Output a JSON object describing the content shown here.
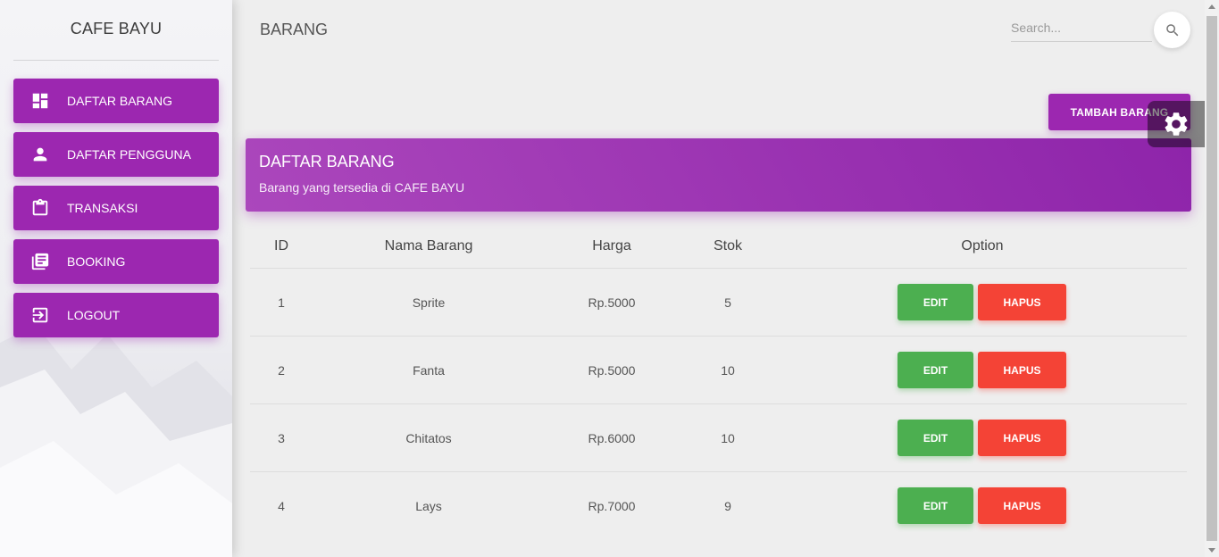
{
  "sidebar": {
    "brand": "CAFE BAYU",
    "items": [
      {
        "label": "DAFTAR BARANG",
        "icon": "dashboard-icon"
      },
      {
        "label": "DAFTAR PENGGUNA",
        "icon": "person-icon"
      },
      {
        "label": "TRANSAKSI",
        "icon": "clipboard-icon"
      },
      {
        "label": "BOOKING",
        "icon": "library-books-icon"
      },
      {
        "label": "LOGOUT",
        "icon": "logout-icon"
      }
    ]
  },
  "header": {
    "title": "BARANG",
    "search_placeholder": "Search..."
  },
  "actions": {
    "add_label": "TAMBAH BARANG"
  },
  "card": {
    "title": "DAFTAR BARANG",
    "subtitle": "Barang yang tersedia di CAFE BAYU"
  },
  "table": {
    "columns": [
      "ID",
      "Nama Barang",
      "Harga",
      "Stok",
      "Option"
    ],
    "rows": [
      {
        "id": "1",
        "name": "Sprite",
        "price": "Rp.5000",
        "stock": "5",
        "edit": "EDIT",
        "delete": "HAPUS"
      },
      {
        "id": "2",
        "name": "Fanta",
        "price": "Rp.5000",
        "stock": "10",
        "edit": "EDIT",
        "delete": "HAPUS"
      },
      {
        "id": "3",
        "name": "Chitatos",
        "price": "Rp.6000",
        "stock": "10",
        "edit": "EDIT",
        "delete": "HAPUS"
      },
      {
        "id": "4",
        "name": "Lays",
        "price": "Rp.7000",
        "stock": "9",
        "edit": "EDIT",
        "delete": "HAPUS"
      }
    ]
  },
  "colors": {
    "primary": "#9c27b0",
    "success": "#4caf50",
    "danger": "#f44336"
  }
}
